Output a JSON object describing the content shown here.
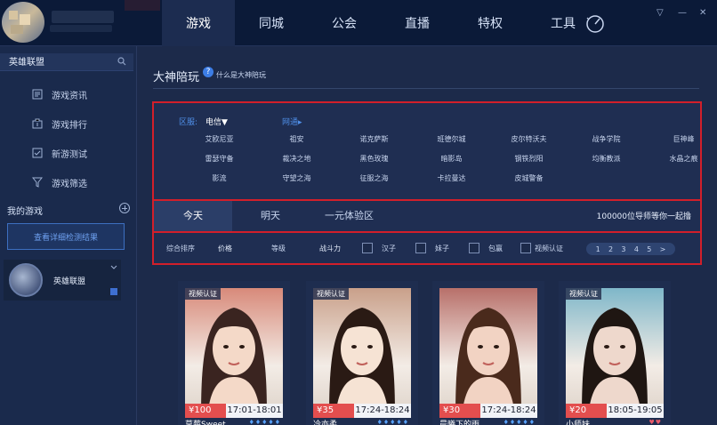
{
  "nav": [
    "游戏",
    "同城",
    "公会",
    "直播",
    "特权",
    "工具"
  ],
  "sidebar": {
    "search_value": "英雄联盟",
    "items": [
      {
        "label": "游戏资讯",
        "icon": "news-icon"
      },
      {
        "label": "游戏排行",
        "icon": "ranking-icon"
      },
      {
        "label": "新游测试",
        "icon": "test-icon"
      },
      {
        "label": "游戏筛选",
        "icon": "filter-icon"
      }
    ],
    "my_games_label": "我的游戏",
    "check_button": "查看详细检测结果",
    "game_name": "英雄联盟"
  },
  "main": {
    "title": "大神陪玩",
    "help_icon": "?",
    "help_text": "什么是大神陪玩",
    "region": {
      "label": "区服:",
      "selected": "电信▼",
      "alt": "网通▸"
    },
    "servers": [
      "艾欧尼亚",
      "祖安",
      "诺克萨斯",
      "班德尔城",
      "皮尔特沃夫",
      "战争学院",
      "巨神峰",
      "雷瑟守备",
      "裁决之地",
      "黑色玫瑰",
      "暗影岛",
      "钢铁烈阳",
      "均衡教派",
      "水晶之痕",
      "影流",
      "守望之海",
      "征服之海",
      "卡拉曼达",
      "皮城警备"
    ],
    "tabs": [
      "今天",
      "明天",
      "一元体验区"
    ],
    "tab_note": "100000位导师等你一起撸",
    "filters": {
      "sort": "综合排序",
      "price": "价格",
      "level": "等级",
      "power": "战斗力",
      "checks": [
        "汉子",
        "妹子",
        "包赢",
        "视频认证"
      ],
      "pages": [
        "1",
        "2",
        "3",
        "4",
        "5",
        ">"
      ]
    },
    "cards": [
      {
        "tag": "视频认证",
        "price": "¥100",
        "time": "17:01-18:01",
        "name": "草莓Sweet...",
        "badges": "♦♦♦♦♦",
        "photo": [
          "#f4d9c8",
          "#3a2420",
          "#d88a7a"
        ]
      },
      {
        "tag": "视频认证",
        "price": "¥35",
        "time": "17:24-18:24",
        "name": "冷亦柔",
        "badges": "♦♦♦♦♦",
        "photo": [
          "#f6e3d4",
          "#2a1a14",
          "#c9a08a"
        ]
      },
      {
        "tag": "",
        "price": "¥30",
        "time": "17:24-18:24",
        "name": "晨曦下的雨...",
        "badges": "♦♦♦♦♦",
        "photo": [
          "#f2d3c3",
          "#4a2a1c",
          "#b8706a"
        ]
      },
      {
        "tag": "视频认证",
        "price": "¥20",
        "time": "18:05-19:05",
        "name": "小师妹",
        "badges": "♥♥",
        "photo": [
          "#eed8cc",
          "#1f1612",
          "#7fb7c9"
        ]
      }
    ]
  },
  "colors": {
    "accent": "#3c7de6",
    "highlight": "#d21f2a",
    "price": "#e34e4e"
  }
}
